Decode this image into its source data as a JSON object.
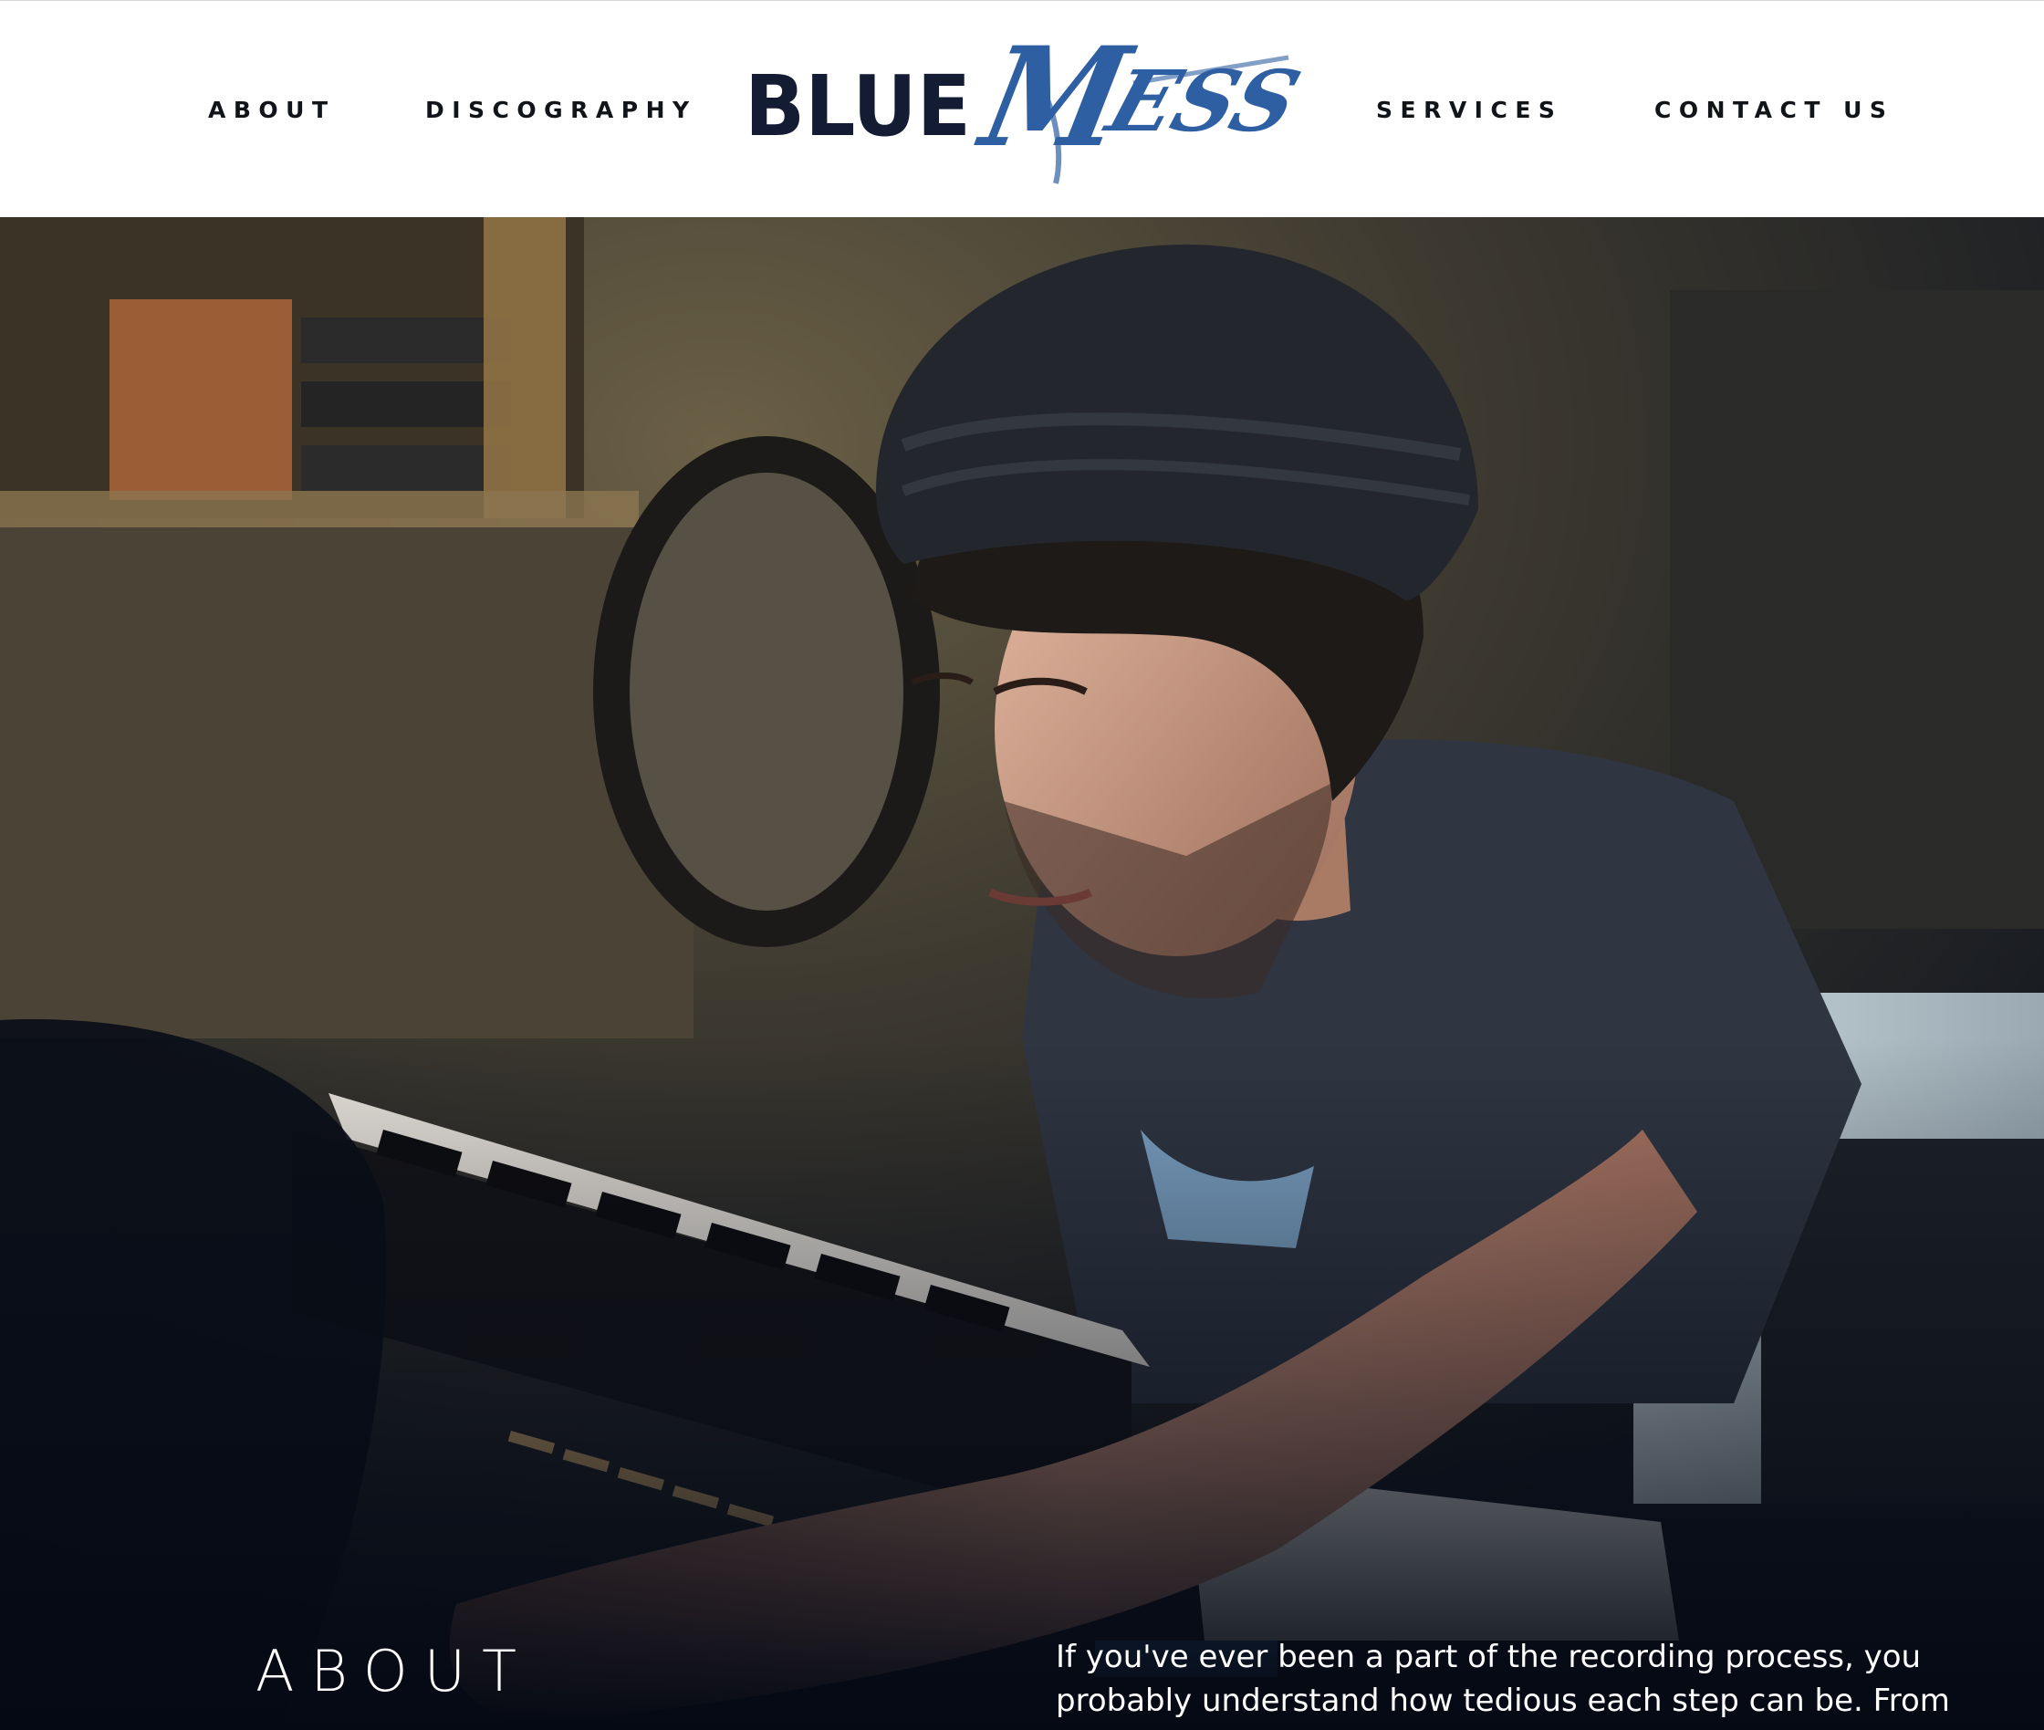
{
  "nav": {
    "left": [
      {
        "label": "ABOUT"
      },
      {
        "label": "DISCOGRAPHY"
      }
    ],
    "right": [
      {
        "label": "SERVICES"
      },
      {
        "label": "CONTACT US"
      }
    ]
  },
  "logo": {
    "word_plain": "BLUE",
    "word_script": "MESS",
    "color_dark": "#141c33",
    "color_blue": "#2e5fa2"
  },
  "about": {
    "heading": "ABOUT",
    "text_lines": [
      "If you've ever been a part of the recording process, you",
      "probably understand how tedious each step can be. From"
    ]
  }
}
